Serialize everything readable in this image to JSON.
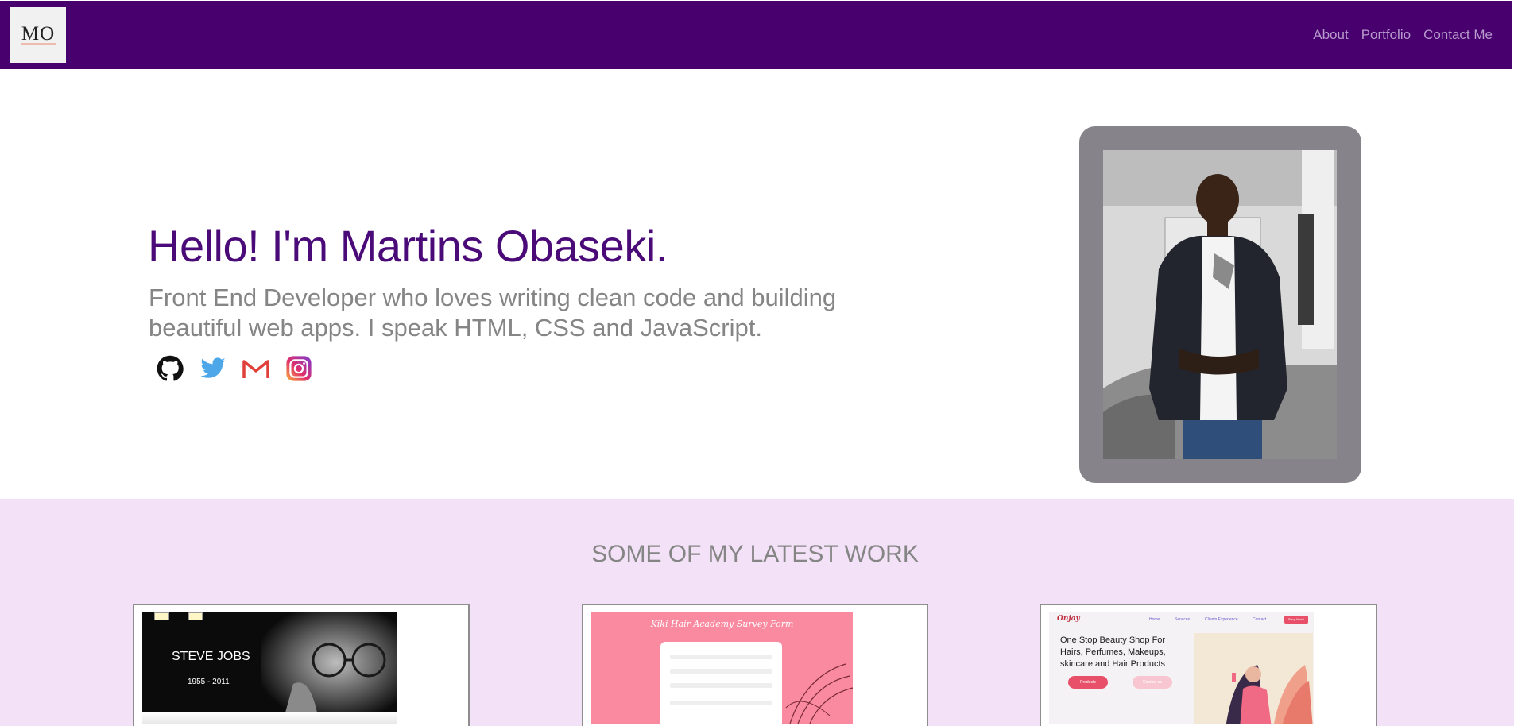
{
  "nav": {
    "logo_text": "MO",
    "links": [
      "About",
      "Portfolio",
      "Contact Me"
    ],
    "bg_color": "#48006f"
  },
  "hero": {
    "title": "Hello! I'm Martins Obaseki.",
    "subtitle": "Front End Developer who loves writing clean code and building beautiful web apps. I speak HTML, CSS and JavaScript.",
    "socials": [
      "github-icon",
      "twitter-icon",
      "gmail-icon",
      "instagram-icon"
    ]
  },
  "work": {
    "heading": "SOME OF MY LATEST WORK",
    "bg_color": "#f3e2f7",
    "projects": [
      {
        "name": "STEVE JOBS",
        "years": "1955 - 2011"
      },
      {
        "name": "Kiki Hair Academy Survey Form"
      },
      {
        "brand": "Onjay",
        "nav": [
          "Home",
          "Services",
          "Clients Experience",
          "Contact"
        ],
        "cta": "Shop Now!!",
        "headline": "One Stop Beauty Shop For Hairs, Perfumes, Makeups, skincare and Hair Products",
        "buttons": [
          "Products",
          "Contact us"
        ]
      }
    ]
  }
}
